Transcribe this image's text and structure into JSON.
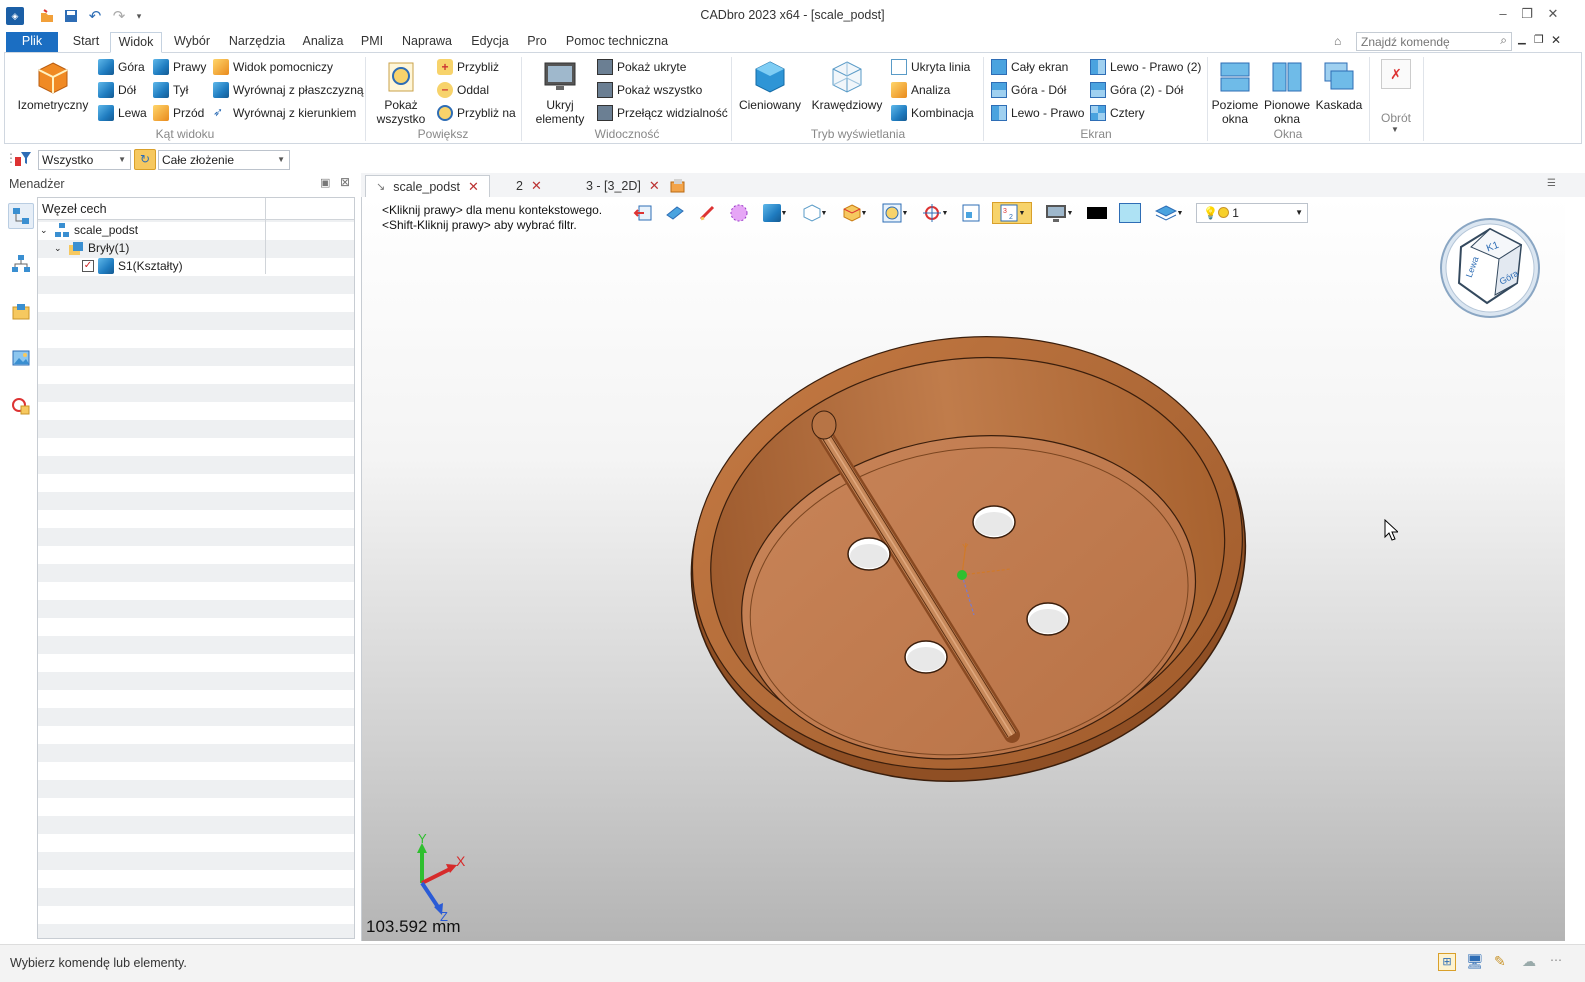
{
  "app": {
    "title": "CADbro 2023 x64 - [scale_podst]"
  },
  "menu_tabs": [
    "Plik",
    "Start",
    "Widok",
    "Wybór",
    "Narzędzia",
    "Analiza",
    "PMI",
    "Naprawa",
    "Edycja",
    "Pro",
    "Pomoc techniczna"
  ],
  "search": {
    "placeholder": "Znajdź komendę"
  },
  "ribbon": {
    "izometryczny": "Izometryczny",
    "gora": "Góra",
    "prawy": "Prawy",
    "widok_pomocniczy": "Widok pomocniczy",
    "dol": "Dół",
    "tyl": "Tył",
    "wyrownaj_plaszczyzna": "Wyrównaj z płaszczyzną",
    "lewa": "Lewa",
    "przod": "Przód",
    "wyrownaj_kierunek": "Wyrównaj z kierunkiem",
    "grp_kat": "Kąt widoku",
    "pokaz_wszystko_l1": "Pokaż",
    "pokaz_wszystko_l2": "wszystko",
    "przybliz": "Przybliż",
    "oddal": "Oddal",
    "przybliz_na": "Przybliż na",
    "grp_powieksz": "Powiększ",
    "ukryj_l1": "Ukryj",
    "ukryj_l2": "elementy",
    "pokaz_ukryte": "Pokaż ukryte",
    "pokaz_wszystko2": "Pokaż wszystko",
    "przelacz": "Przełącz widzialność",
    "grp_widocznosc": "Widoczność",
    "cieniowany": "Cieniowany",
    "krawedziowy": "Krawędziowy",
    "ukryta_linia": "Ukryta linia",
    "analiza": "Analiza",
    "kombinacja": "Kombinacja",
    "grp_tryb": "Tryb wyświetlania",
    "caly_ekran": "Cały ekran",
    "gora_dol": "Góra - Dół",
    "lewo_prawo": "Lewo - Prawo",
    "lewo_prawo2": "Lewo - Prawo (2)",
    "gora2_dol": "Góra (2) - Dół",
    "cztery": "Cztery",
    "grp_ekran": "Ekran",
    "poziome_l1": "Poziome",
    "poziome_l2": "okna",
    "pionowe_l1": "Pionowe",
    "pionowe_l2": "okna",
    "kaskada": "Kaskada",
    "grp_okna": "Okna",
    "obrot": "Obrót"
  },
  "filters": {
    "filter1": "Wszystko",
    "filter2": "Całe złożenie"
  },
  "manager": {
    "title": "Menadżer",
    "column": "Węzeł cech",
    "nodes": [
      "scale_podst",
      "Bryły(1)",
      "S1(Kształty)"
    ]
  },
  "doc_tabs": [
    "scale_podst",
    "2",
    "3 - [3_2D]"
  ],
  "viewport": {
    "hint1": "<Kliknij prawy> dla menu kontekstowego.",
    "hint2": "<Shift-Kliknij prawy> aby wybrać filtr.",
    "light_value": "1",
    "scale": "103.592 mm",
    "axis_x": "X",
    "axis_y": "Y",
    "axis_z": "Z",
    "cube_top": "Góra",
    "cube_front": "Lewa"
  },
  "status": {
    "text": "Wybierz komendę lub elementy."
  },
  "colors": {
    "accent": "#1b6ec2",
    "part": "#c98a5c"
  }
}
